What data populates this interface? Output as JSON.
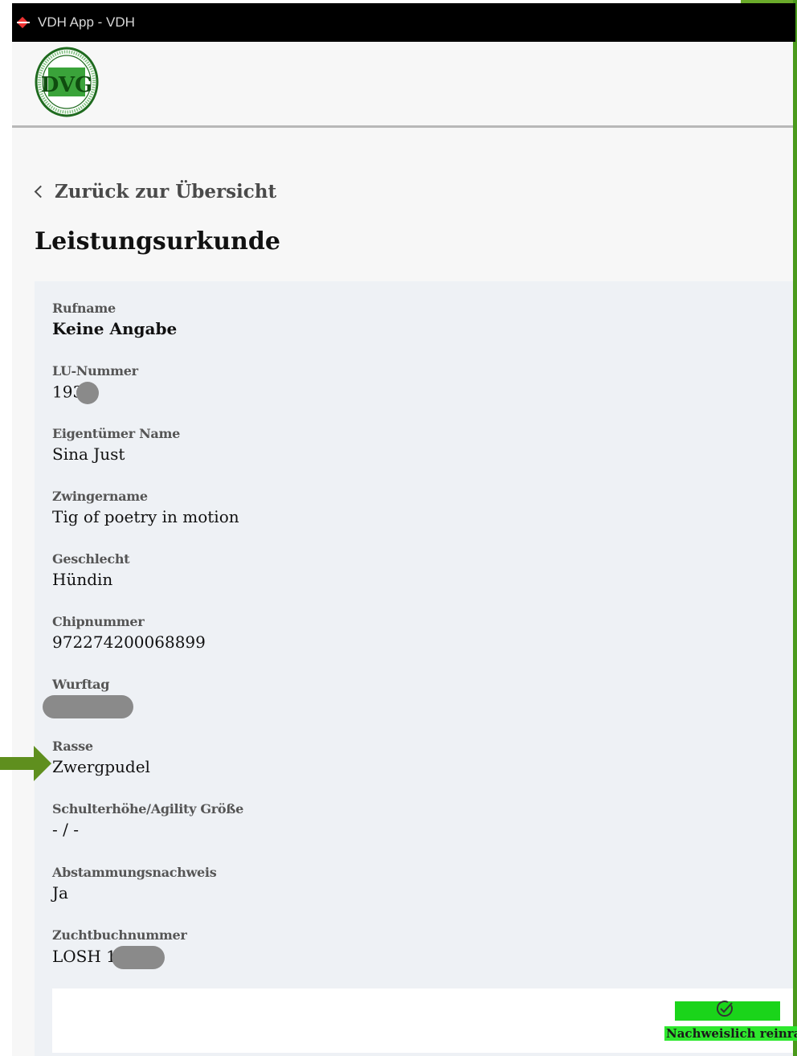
{
  "window": {
    "title": "VDH App - VDH"
  },
  "header": {
    "logo_text": "DVG"
  },
  "nav": {
    "back_label": "Zurück zur Übersicht"
  },
  "page": {
    "title": "Leistungsurkunde"
  },
  "fields": [
    {
      "label": "Rufname",
      "value": "Keine Angabe"
    },
    {
      "label": "LU-Nummer",
      "value": "193"
    },
    {
      "label": "Eigentümer Name",
      "value": "Sina Just"
    },
    {
      "label": "Zwingername",
      "value": "Tig of poetry in motion"
    },
    {
      "label": "Geschlecht",
      "value": "Hündin"
    },
    {
      "label": "Chipnummer",
      "value": "972274200068899"
    },
    {
      "label": "Wurftag",
      "value": ""
    },
    {
      "label": "Rasse",
      "value": "Zwergpudel"
    },
    {
      "label": "Schulterhöhe/Agility Größe",
      "value": "- / -"
    },
    {
      "label": "Abstammungsnachweis",
      "value": "Ja"
    },
    {
      "label": "Zuchtbuchnummer",
      "value": "LOSH 1"
    }
  ],
  "badge": {
    "label": "Nachweislich reinrassig",
    "icon": "check-circle-icon",
    "color": "#1ad41a"
  },
  "annotation": {
    "icon": "arrow-right-icon",
    "color": "#5f8f1e"
  }
}
